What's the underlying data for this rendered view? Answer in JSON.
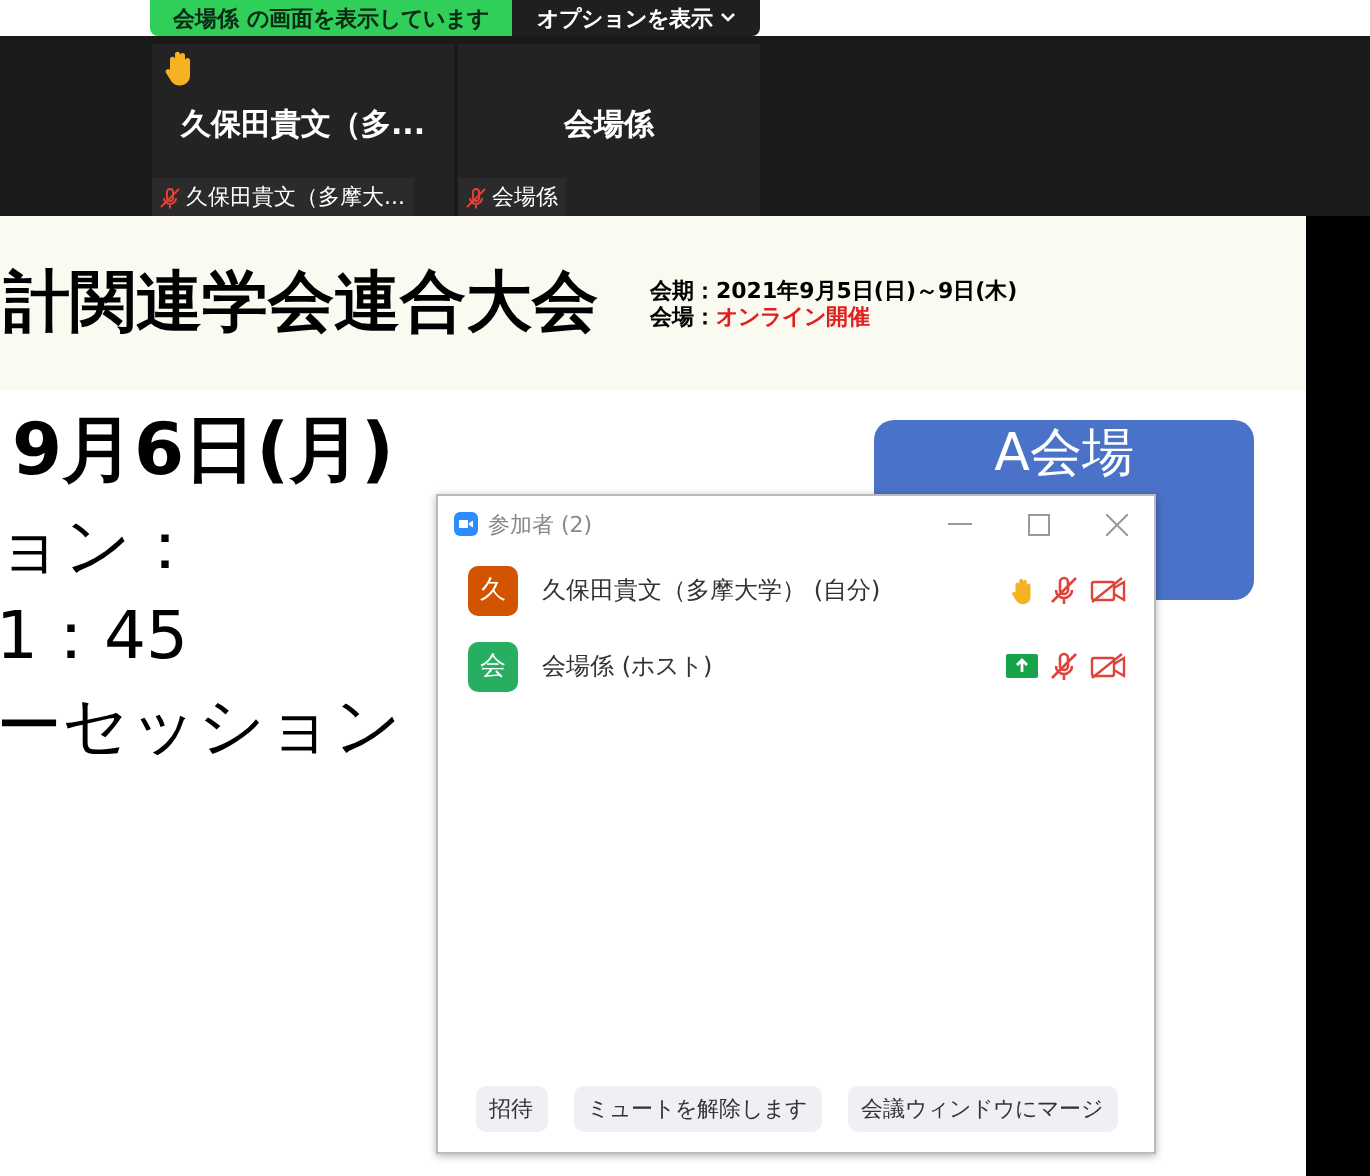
{
  "share_banner": {
    "text": "会場係 の画面を表示しています",
    "options_button": "オプションを表示"
  },
  "video_tiles": [
    {
      "display_name": "久保田貴文（多...",
      "label": "久保田貴文（多摩大...",
      "hand_raised": true,
      "muted": true
    },
    {
      "display_name": "会場係",
      "label": "会場係",
      "hand_raised": false,
      "muted": true
    }
  ],
  "slide": {
    "title": "計関連学会連合大会",
    "period": "会期：2021年9月5日(日)～9日(木)",
    "venue_label": "会場：",
    "venue": "オンライン開催",
    "date": "9月6日(月)",
    "lines": [
      "ョン：",
      "1：45",
      "ーセッション"
    ],
    "room": "A会場"
  },
  "participants_window": {
    "title": "参加者 (2)",
    "participants": [
      {
        "initial": "久",
        "color": "#d35400",
        "name": "久保田貴文（多摩大学） (自分)",
        "status": [
          {
            "kind": "hand"
          },
          {
            "kind": "mic-off"
          },
          {
            "kind": "video-off"
          }
        ]
      },
      {
        "initial": "会",
        "color": "#27ae60",
        "name": "会場係 (ホスト)",
        "status": [
          {
            "kind": "share"
          },
          {
            "kind": "mic-off"
          },
          {
            "kind": "video-off"
          }
        ]
      }
    ],
    "buttons": [
      "招待",
      "ミュートを解除します",
      "会議ウィンドウにマージ"
    ]
  }
}
